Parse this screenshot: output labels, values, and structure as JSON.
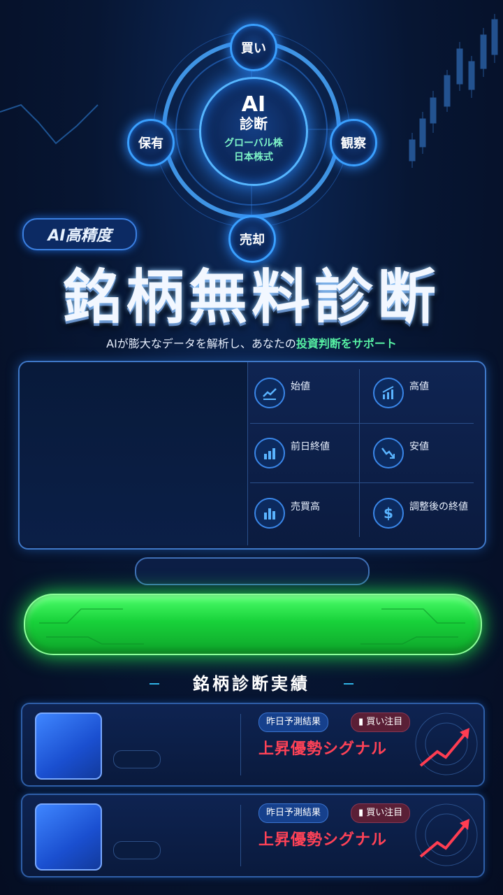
{
  "diagram": {
    "core_title": "AI",
    "core_subtitle": "診断",
    "markets": [
      "グローバル株",
      "日本株式"
    ],
    "nodes": {
      "top": "買い",
      "left": "保有",
      "right": "観察",
      "bottom": "売却"
    }
  },
  "badge": "AI高精度",
  "headline": "銘柄無料診断",
  "tagline": {
    "prefix": "AIが膨大なデータを解析し、あなたの",
    "highlight": "投資判断をサポート"
  },
  "info_items": [
    {
      "label": "始値",
      "icon": "trend-up-icon"
    },
    {
      "label": "高値",
      "icon": "bar-rise-icon"
    },
    {
      "label": "前日終値",
      "icon": "bar-chart-icon"
    },
    {
      "label": "安値",
      "icon": "trend-down-icon"
    },
    {
      "label": "売買高",
      "icon": "volume-icon"
    },
    {
      "label": "調整後の終値",
      "icon": "dollar-icon"
    }
  ],
  "results_title": "銘柄診断実績",
  "results": [
    {
      "tag": "昨日予測結果",
      "action": "買い注目",
      "signal": "上昇優勢シグナル"
    },
    {
      "tag": "昨日予測結果",
      "action": "買い注目",
      "signal": "上昇優勢シグナル"
    }
  ],
  "colors": {
    "accent": "#3aa0ff",
    "cta": "#18d23a",
    "signal": "#ff4257",
    "highlight": "#56f0a3"
  }
}
